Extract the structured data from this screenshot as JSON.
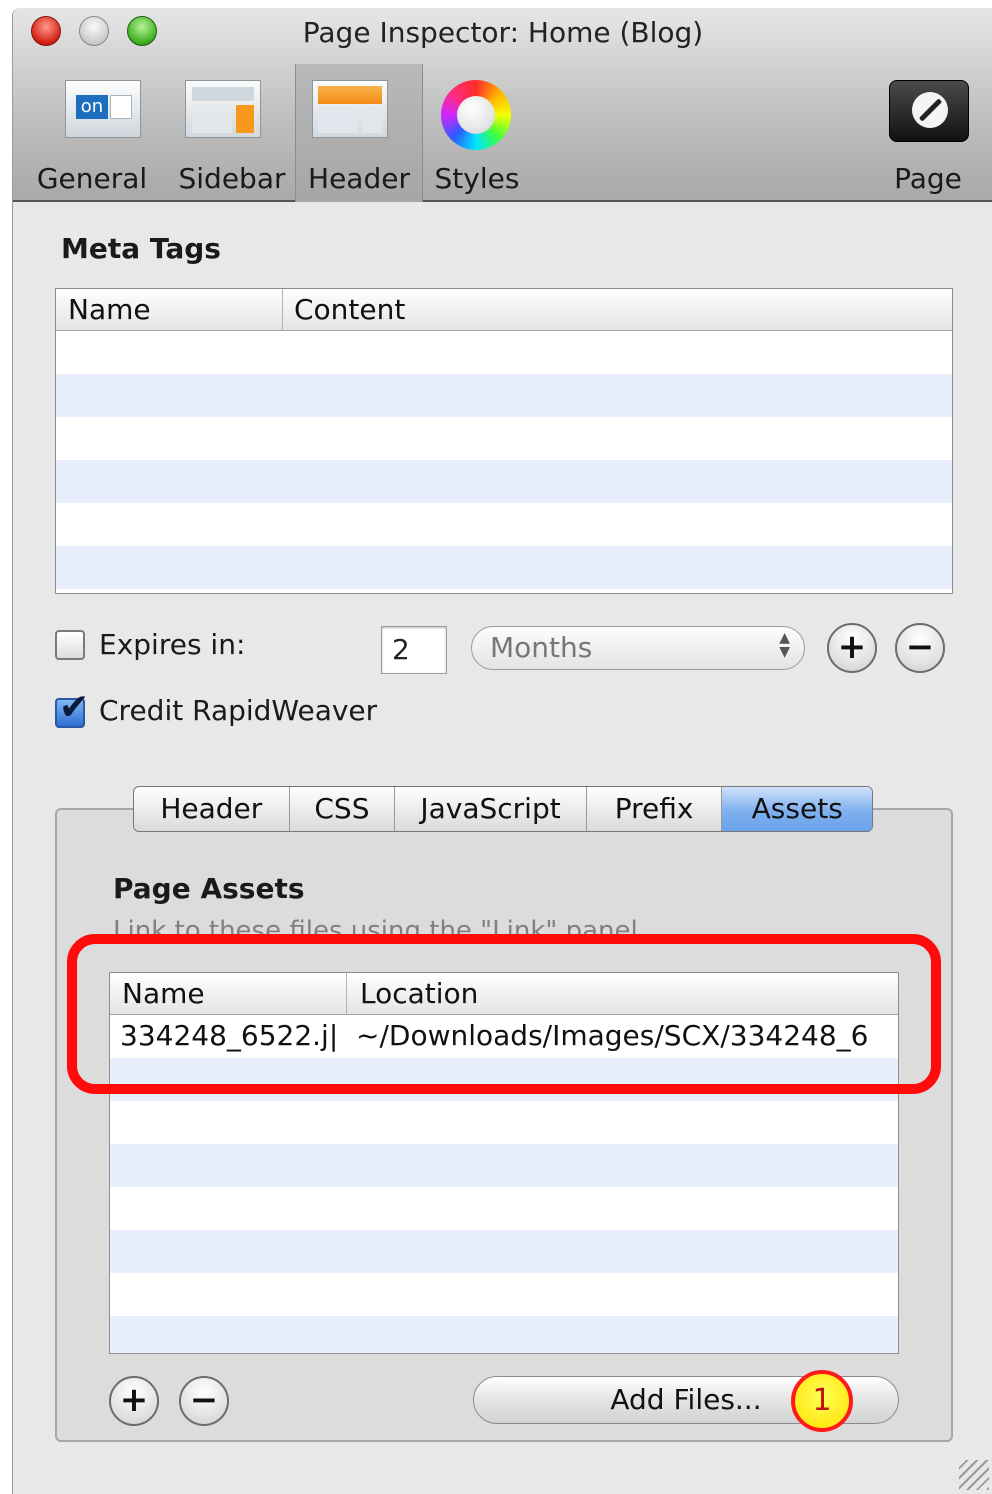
{
  "window": {
    "title": "Page Inspector: Home (Blog)"
  },
  "toolbar": {
    "items": [
      {
        "label": "General",
        "icon": "general-icon"
      },
      {
        "label": "Sidebar",
        "icon": "sidebar-layout-icon"
      },
      {
        "label": "Header",
        "icon": "header-layout-icon",
        "selected": true
      },
      {
        "label": "Styles",
        "icon": "color-wheel-icon"
      },
      {
        "label": "Page",
        "icon": "wrench-icon"
      }
    ],
    "general_icon_text": "on"
  },
  "meta_tags": {
    "title": "Meta Tags",
    "columns": [
      "Name",
      "Content"
    ]
  },
  "expires": {
    "label": "Expires in:",
    "checked": false,
    "value": "2",
    "unit": "Months"
  },
  "credit": {
    "label": "Credit RapidWeaver",
    "checked": true
  },
  "tabs": [
    "Header",
    "CSS",
    "JavaScript",
    "Prefix",
    "Assets"
  ],
  "selected_tab": "Assets",
  "assets": {
    "title": "Page Assets",
    "subtitle": "Link to these files using the \"Link\" panel",
    "columns": [
      "Name",
      "Location"
    ],
    "rows": [
      {
        "name": "334248_6522.j|",
        "location": "~/Downloads/Images/SCX/334248_6"
      }
    ]
  },
  "buttons": {
    "add": "+",
    "remove": "−",
    "add_files": "Add Files..."
  },
  "annotation": {
    "badge": "1"
  },
  "colors": {
    "highlight": "#ff0b0b",
    "selected_tab": "#7fb0ef",
    "row_stripe": "#e8eefb"
  }
}
